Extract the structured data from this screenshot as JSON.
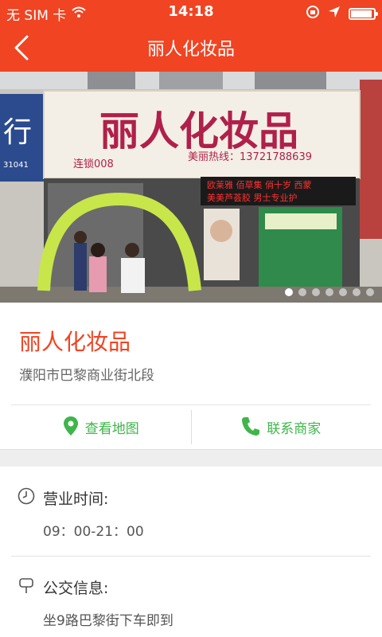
{
  "status_bar": {
    "carrier": "无 SIM 卡",
    "time": "14:18"
  },
  "nav": {
    "title": "丽人化妆品"
  },
  "hero": {
    "signboard": "丽人化妆品",
    "branch": "连锁008",
    "hotline": "美丽热线：13721788639",
    "led_line1": "欧莱雅 佰草集 俏十岁 西蒙",
    "led_line2": "美美芦荟胶 男士专业护",
    "slide_count": 7,
    "active_slide": 0
  },
  "store": {
    "name": "丽人化妆品",
    "address": "濮阳市巴黎商业街北段"
  },
  "actions": {
    "map_label": "查看地图",
    "contact_label": "联系商家"
  },
  "info": {
    "hours_title": "营业时间:",
    "hours_value": "09：00-21：00",
    "bus_title": "公交信息:",
    "bus_value": "坐9路巴黎街下车即到"
  },
  "colors": {
    "brand": "#f04422",
    "accent_green": "#3fb54a"
  }
}
